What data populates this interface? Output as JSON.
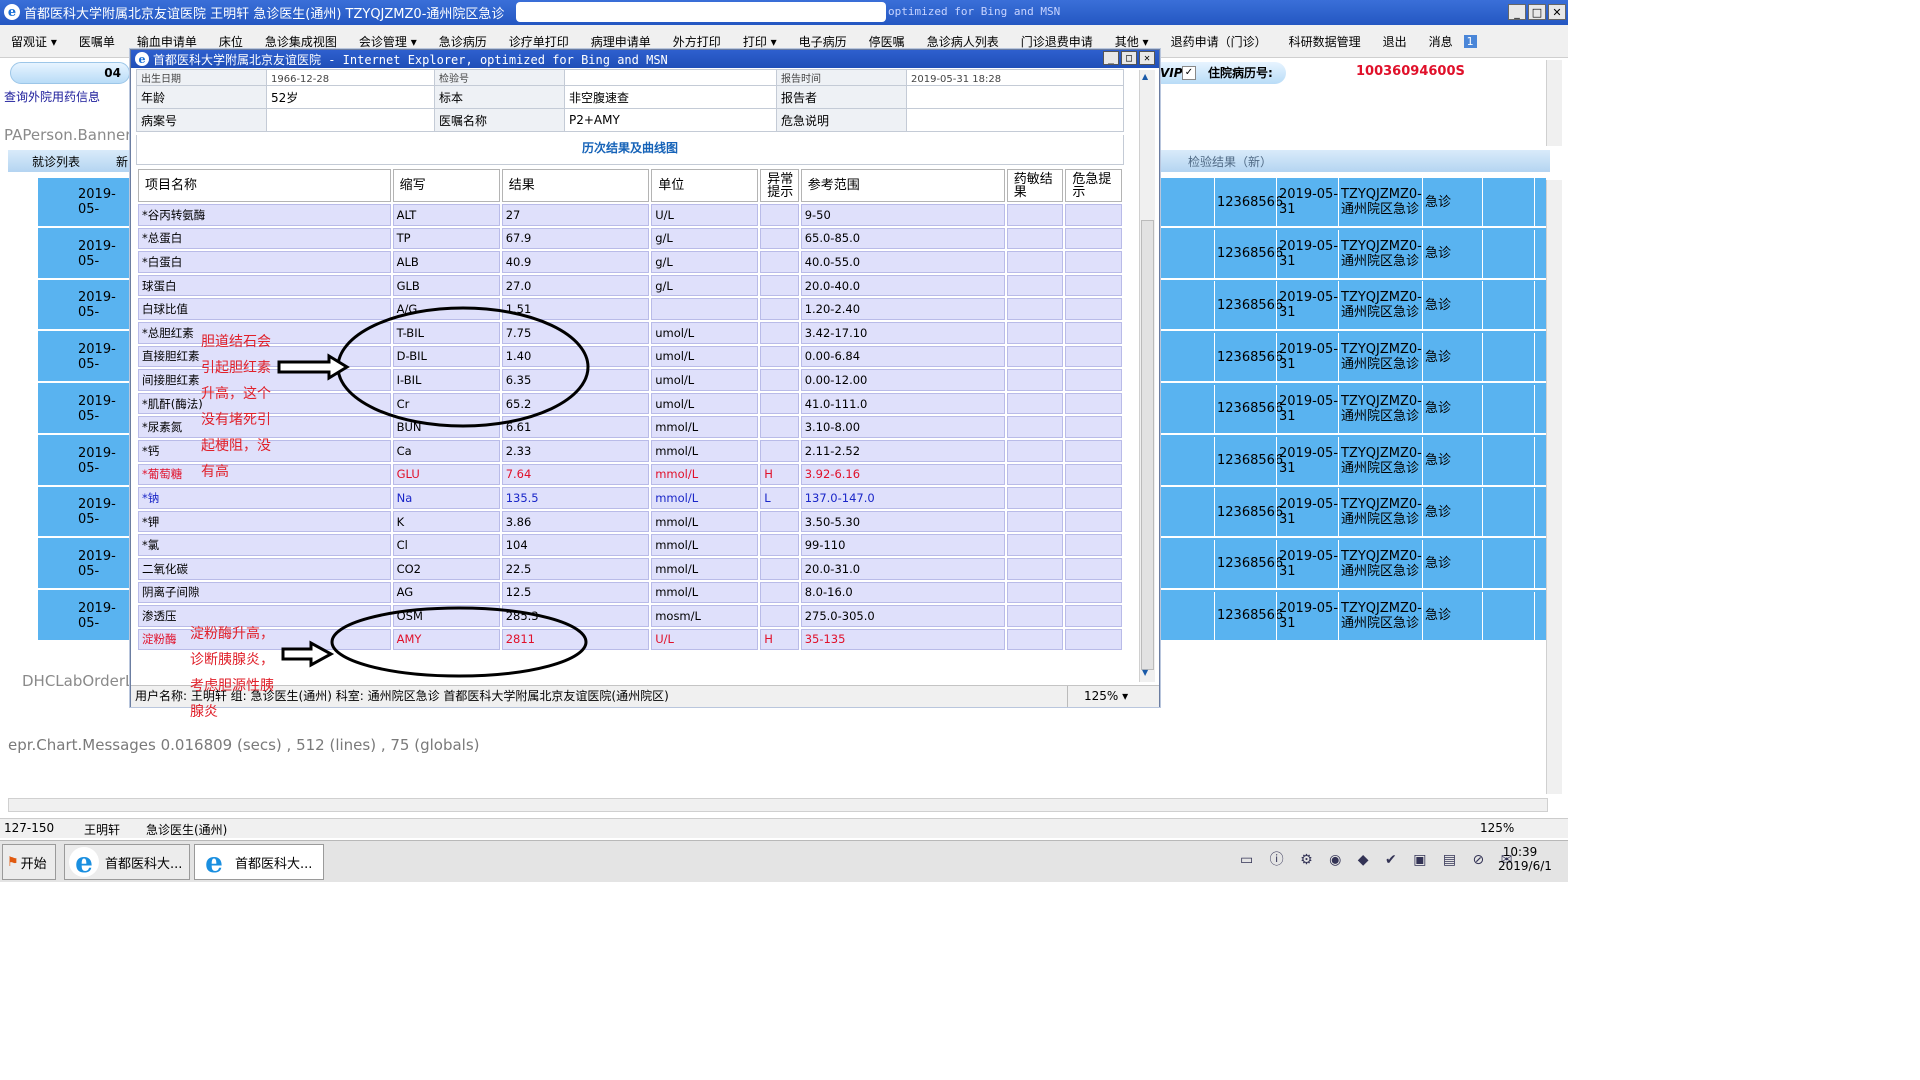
{
  "window": {
    "title": "首都医科大学附属北京友谊医院  王明轩  急诊医生(通州)  TZYQJZMZ0-通州院区急诊",
    "title_suffix": "optimized for Bing and MSN"
  },
  "menu": [
    "留观证 ▾",
    "医嘱单",
    "输血申请单",
    "床位",
    "急诊集成视图",
    "会诊管理 ▾",
    "急诊病历",
    "诊疗单打印",
    "病理申请单",
    "外方打印",
    "打印 ▾",
    "电子病历",
    "停医嘱",
    "急诊病人列表",
    "门诊退费申请",
    "其他 ▾",
    "退药申请（门诊）",
    "科研数据管理",
    "退出",
    "消息"
  ],
  "menu_badge": "1",
  "banner": {
    "pill_number": "04",
    "vip_label": "VIP",
    "inpatient_label": "住院病历号:",
    "inpatient_number": "10036094600S"
  },
  "left_panel": {
    "query_link": "查询外院用药信息",
    "paperson_banner": "PAPerson.Banner",
    "tab_1": "就诊列表",
    "tab_2": "新",
    "lab_order": "DHCLabOrderL",
    "chart_messages": "epr.Chart.Messages    0.016809 (secs) ,  512 (lines) ,  75 (globals)"
  },
  "right_panel": {
    "tab_label": "检验结果（新）"
  },
  "bg_rows": [
    {
      "date": "2019-05-",
      "id": "12368566",
      "date2": "2019-05-31",
      "dept": "TZYQJZMZ0-通州院区急诊",
      "type": "急诊"
    },
    {
      "date": "2019-05-",
      "id": "12368566",
      "date2": "2019-05-31",
      "dept": "TZYQJZMZ0-通州院区急诊",
      "type": "急诊"
    },
    {
      "date": "2019-05-",
      "id": "12368566",
      "date2": "2019-05-31",
      "dept": "TZYQJZMZ0-通州院区急诊",
      "type": "急诊"
    },
    {
      "date": "2019-05-",
      "id": "12368566",
      "date2": "2019-05-31",
      "dept": "TZYQJZMZ0-通州院区急诊",
      "type": "急诊"
    },
    {
      "date": "2019-05-",
      "id": "12368566",
      "date2": "2019-05-31",
      "dept": "TZYQJZMZ0-通州院区急诊",
      "type": "急诊"
    },
    {
      "date": "2019-05-",
      "id": "12368566",
      "date2": "2019-05-31",
      "dept": "TZYQJZMZ0-通州院区急诊",
      "type": "急诊"
    },
    {
      "date": "2019-05-",
      "id": "12368566",
      "date2": "2019-05-31",
      "dept": "TZYQJZMZ0-通州院区急诊",
      "type": "急诊"
    },
    {
      "date": "2019-05-",
      "id": "12368566",
      "date2": "2019-05-31",
      "dept": "TZYQJZMZ0-通州院区急诊",
      "type": "急诊"
    },
    {
      "date": "2019-05-",
      "id": "12368566",
      "date2": "2019-05-31",
      "dept": "TZYQJZMZ0-通州院区急诊",
      "type": "急诊"
    }
  ],
  "popup": {
    "title": "首都医科大学附属北京友谊医院 - Internet Explorer, optimized for Bing and MSN",
    "info": {
      "birth_label": "出生日期",
      "birth": "1966-12-28",
      "barcode_label": "检验号",
      "barcode": "",
      "report_time_label": "报告时间",
      "report_time": "2019-05-31 18:28",
      "age_label": "年龄",
      "age": "52岁",
      "specimen_label": "标本",
      "specimen": "非空腹速查",
      "reporter_label": "报告者",
      "reporter": "",
      "record_label": "病案号",
      "record": "",
      "order_label": "医嘱名称",
      "order": "P2+AMY",
      "critical_label": "危急说明",
      "critical": ""
    },
    "history_link": "历次结果及曲线图",
    "columns": [
      "项目名称",
      "缩写",
      "结果",
      "单位",
      "异常提示",
      "参考范围",
      "药敏结果",
      "危急提示"
    ],
    "rows": [
      {
        "name": "*谷丙转氨酶",
        "abbr": "ALT",
        "result": "27",
        "unit": "U/L",
        "flag": "",
        "range": "9-50",
        "style": ""
      },
      {
        "name": "*总蛋白",
        "abbr": "TP",
        "result": "67.9",
        "unit": "g/L",
        "flag": "",
        "range": "65.0-85.0",
        "style": ""
      },
      {
        "name": "*白蛋白",
        "abbr": "ALB",
        "result": "40.9",
        "unit": "g/L",
        "flag": "",
        "range": "40.0-55.0",
        "style": ""
      },
      {
        "name": "球蛋白",
        "abbr": "GLB",
        "result": "27.0",
        "unit": "g/L",
        "flag": "",
        "range": "20.0-40.0",
        "style": ""
      },
      {
        "name": "白球比值",
        "abbr": "A/G",
        "result": "1.51",
        "unit": "",
        "flag": "",
        "range": "1.20-2.40",
        "style": ""
      },
      {
        "name": "*总胆红素",
        "abbr": "T-BIL",
        "result": "7.75",
        "unit": "umol/L",
        "flag": "",
        "range": "3.42-17.10",
        "style": ""
      },
      {
        "name": "直接胆红素",
        "abbr": "D-BIL",
        "result": "1.40",
        "unit": "umol/L",
        "flag": "",
        "range": "0.00-6.84",
        "style": ""
      },
      {
        "name": "间接胆红素",
        "abbr": "I-BIL",
        "result": "6.35",
        "unit": "umol/L",
        "flag": "",
        "range": "0.00-12.00",
        "style": ""
      },
      {
        "name": "*肌酐(酶法)",
        "abbr": "Cr",
        "result": "65.2",
        "unit": "umol/L",
        "flag": "",
        "range": "41.0-111.0",
        "style": ""
      },
      {
        "name": "*尿素氮",
        "abbr": "BUN",
        "result": "6.61",
        "unit": "mmol/L",
        "flag": "",
        "range": "3.10-8.00",
        "style": ""
      },
      {
        "name": "*钙",
        "abbr": "Ca",
        "result": "2.33",
        "unit": "mmol/L",
        "flag": "",
        "range": "2.11-2.52",
        "style": ""
      },
      {
        "name": "*葡萄糖",
        "abbr": "GLU",
        "result": "7.64",
        "unit": "mmol/L",
        "flag": "H",
        "range": "3.92-6.16",
        "style": "red"
      },
      {
        "name": "*钠",
        "abbr": "Na",
        "result": "135.5",
        "unit": "mmol/L",
        "flag": "L",
        "range": "137.0-147.0",
        "style": "blue"
      },
      {
        "name": "*钾",
        "abbr": "K",
        "result": "3.86",
        "unit": "mmol/L",
        "flag": "",
        "range": "3.50-5.30",
        "style": ""
      },
      {
        "name": "*氯",
        "abbr": "Cl",
        "result": "104",
        "unit": "mmol/L",
        "flag": "",
        "range": "99-110",
        "style": ""
      },
      {
        "name": "二氧化碳",
        "abbr": "CO2",
        "result": "22.5",
        "unit": "mmol/L",
        "flag": "",
        "range": "20.0-31.0",
        "style": ""
      },
      {
        "name": "阴离子间隙",
        "abbr": "AG",
        "result": "12.5",
        "unit": "mmol/L",
        "flag": "",
        "range": "8.0-16.0",
        "style": ""
      },
      {
        "name": "渗透压",
        "abbr": "OSM",
        "result": "285.3",
        "unit": "mosm/L",
        "flag": "",
        "range": "275.0-305.0",
        "style": ""
      },
      {
        "name": "淀粉酶",
        "abbr": "AMY",
        "result": "2811",
        "unit": "U/L",
        "flag": "H",
        "range": "35-135",
        "style": "red"
      }
    ],
    "annotation_bilirubin": [
      "胆道结石会",
      "引起胆红素",
      "升高，这个",
      "没有堵死引",
      "起梗阻，没",
      "有高"
    ],
    "annotation_amylase": [
      "淀粉酶升高，",
      "诊断胰腺炎，",
      "考虑胆源性胰",
      "腺炎"
    ],
    "status": "用户名称:  王明轩   组:  急诊医生(通州)   科室:  通州院区急诊  首都医科大学附属北京友谊医院(通州院区)",
    "zoom": "125%"
  },
  "statusbar": {
    "range": "127-150",
    "user": "王明轩",
    "group": "急诊医生(通州)",
    "zoom": "125%"
  },
  "taskbar": {
    "start": "开始",
    "btn1": "首都医科大...",
    "btn2": "首都医科大...",
    "time": "10:39",
    "date": "2019/6/1"
  }
}
